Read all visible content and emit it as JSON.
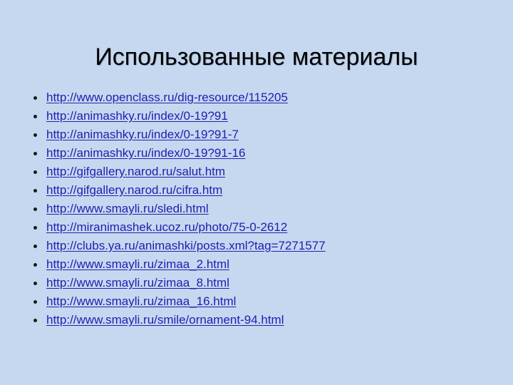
{
  "slide": {
    "title": "Использованные материалы",
    "background_color": "#c6d8f0",
    "title_color": "#000000",
    "link_color": "#2020b0",
    "bullet_color": "#1a1a1a",
    "bullet_glyph": "•",
    "links": [
      {
        "url": "http://www.openclass.ru/dig-resource/115205"
      },
      {
        "url": "http://animashky.ru/index/0-19?91"
      },
      {
        "url": "http://animashky.ru/index/0-19?91-7"
      },
      {
        "url": "http://animashky.ru/index/0-19?91-16"
      },
      {
        "url": "http://gifgallery.narod.ru/salut.htm"
      },
      {
        "url": "http://gifgallery.narod.ru/cifra.htm"
      },
      {
        "url": "http://www.smayli.ru/sledi.html"
      },
      {
        "url": "http://miranimashek.ucoz.ru/photo/75-0-2612"
      },
      {
        "url": "http://clubs.ya.ru/animashki/posts.xml?tag=7271577"
      },
      {
        "url": "http://www.smayli.ru/zimaa_2.html"
      },
      {
        "url": "http://www.smayli.ru/zimaa_8.html"
      },
      {
        "url": "http://www.smayli.ru/zimaa_16.html"
      },
      {
        "url": "http://www.smayli.ru/smile/ornament-94.html"
      }
    ]
  }
}
